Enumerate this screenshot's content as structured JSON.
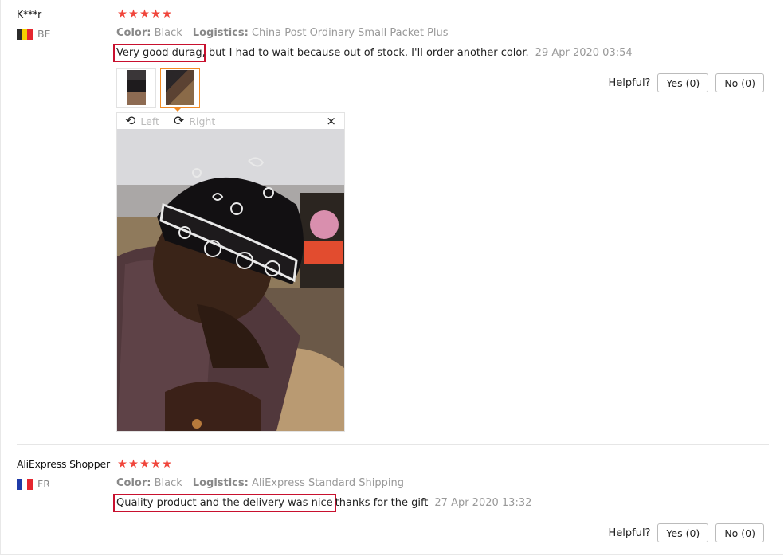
{
  "stars": [
    "★",
    "★",
    "★",
    "★",
    "★"
  ],
  "reviews": [
    {
      "user": "K***r",
      "country": "BE",
      "color_label": "Color:",
      "color_value": "Black",
      "logistics_label": "Logistics:",
      "logistics_value": "China Post Ordinary Small Packet Plus",
      "text_highlight": "Very good durag",
      "text_rest": ", but I had to wait because out of stock. I'll order another color.",
      "date": "29 Apr 2020 03:54",
      "helpful_label": "Helpful?",
      "yes_label": "Yes (0)",
      "no_label": "No (0)"
    },
    {
      "user": "AliExpress Shopper",
      "country": "FR",
      "color_label": "Color:",
      "color_value": "Black",
      "logistics_label": "Logistics:",
      "logistics_value": "AliExpress Standard Shipping",
      "text_highlight": "Quality product and the delivery was nice",
      "text_rest": "thanks for the gift",
      "date": "27 Apr 2020 13:32",
      "helpful_label": "Helpful?",
      "yes_label": "Yes (0)",
      "no_label": "No (0)"
    }
  ],
  "viewer": {
    "left_label": "Left",
    "right_label": "Right",
    "close_icon": "×",
    "rotate_left_icon": "⟲",
    "rotate_right_icon": "⟳"
  },
  "colors": {
    "star": "#f0453b",
    "highlight_border": "#c8102e",
    "active_thumb": "#f08a24"
  }
}
